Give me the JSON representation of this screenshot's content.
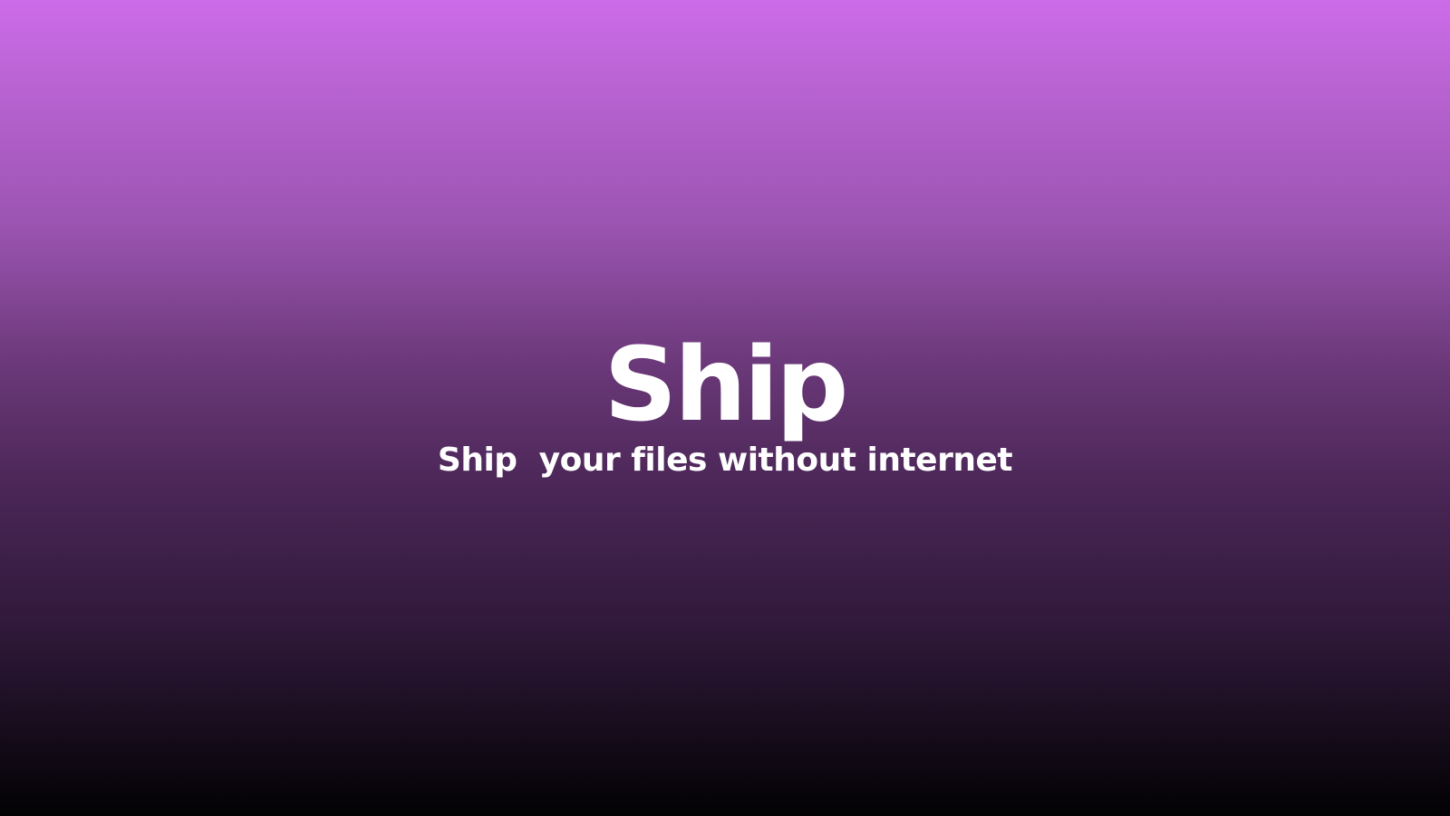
{
  "hero": {
    "title": "Ship",
    "subtitle": "Ship  your files without internet"
  },
  "colors": {
    "gradient_top": "#cc6ce8",
    "gradient_bottom": "#020103",
    "text": "#ffffff"
  }
}
